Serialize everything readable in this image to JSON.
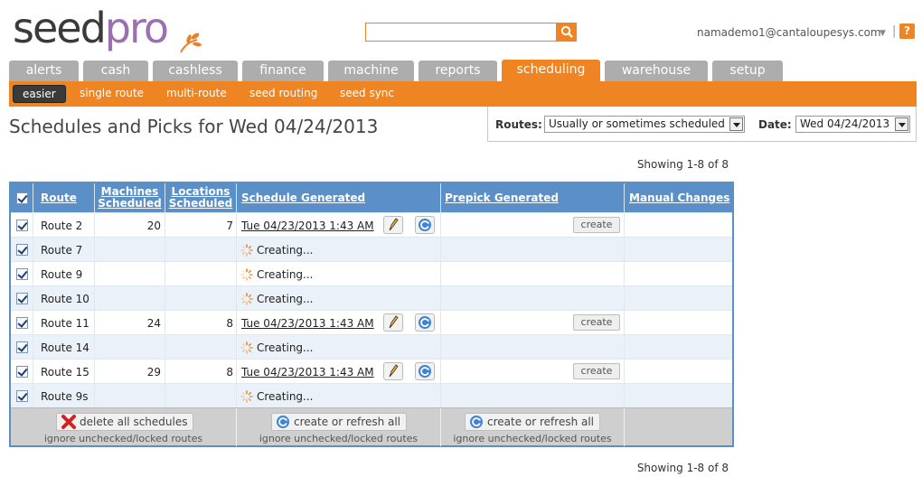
{
  "header": {
    "logo_text_dark": "seed",
    "logo_text_light": "pro",
    "search_value": "",
    "user_email": "namademo1@cantaloupesys.com",
    "help_label": "?"
  },
  "tabs": [
    "alerts",
    "cash",
    "cashless",
    "finance",
    "machine",
    "reports",
    "scheduling",
    "warehouse",
    "setup"
  ],
  "active_tab": "scheduling",
  "subnav": [
    "easier",
    "single route",
    "multi-route",
    "seed routing",
    "seed sync"
  ],
  "active_subnav": "easier",
  "page_title": "Schedules and Picks for Wed 04/24/2013",
  "filters": {
    "routes_label": "Routes:",
    "routes_value": "Usually or sometimes scheduled",
    "date_label": "Date:",
    "date_value": "Wed 04/24/2013"
  },
  "showing_text": "Showing 1-8 of 8",
  "table": {
    "headers": {
      "route": "Route",
      "machines_1": "Machines",
      "machines_2": "Scheduled",
      "locations_1": "Locations",
      "locations_2": "Scheduled",
      "schedule_generated": "Schedule Generated",
      "prepick_generated": "Prepick Generated",
      "manual_changes": "Manual Changes"
    },
    "rows": [
      {
        "route": "Route 2",
        "machines": "20",
        "locations": "7",
        "schedule": "Tue 04/23/2013 1:43 AM",
        "prepick": "create"
      },
      {
        "route": "Route 7",
        "machines": "",
        "locations": "",
        "schedule": "Creating...",
        "prepick": ""
      },
      {
        "route": "Route 9",
        "machines": "",
        "locations": "",
        "schedule": "Creating...",
        "prepick": ""
      },
      {
        "route": "Route 10",
        "machines": "",
        "locations": "",
        "schedule": "Creating...",
        "prepick": ""
      },
      {
        "route": "Route 11",
        "machines": "24",
        "locations": "8",
        "schedule": "Tue 04/23/2013 1:43 AM",
        "prepick": "create"
      },
      {
        "route": "Route 14",
        "machines": "",
        "locations": "",
        "schedule": "Creating...",
        "prepick": ""
      },
      {
        "route": "Route 15",
        "machines": "29",
        "locations": "8",
        "schedule": "Tue 04/23/2013 1:43 AM",
        "prepick": "create"
      },
      {
        "route": "Route 9s",
        "machines": "",
        "locations": "",
        "schedule": "Creating...",
        "prepick": ""
      }
    ],
    "footer": {
      "delete_label": "delete all schedules",
      "refresh_schedule_label": "create or refresh all",
      "refresh_prepick_label": "create or refresh all",
      "note": "ignore unchecked/locked routes"
    }
  },
  "colors": {
    "accent": "#ee8422",
    "tab_inactive": "#adadad",
    "table_header": "#5b8fc7",
    "row_alt": "#eaf1f8"
  }
}
